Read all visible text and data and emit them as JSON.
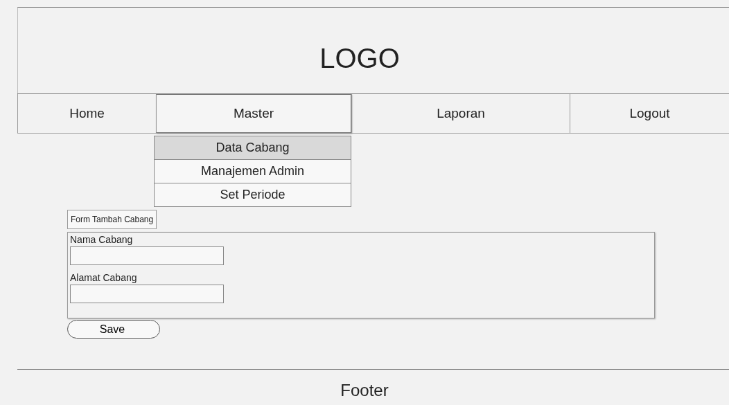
{
  "header": {
    "logo": "LOGO"
  },
  "nav": [
    {
      "label": "Home",
      "selected": false
    },
    {
      "label": "Master",
      "selected": true
    },
    {
      "label": "Laporan",
      "selected": false
    },
    {
      "label": "Logout",
      "selected": false
    }
  ],
  "dropdown": [
    {
      "label": "Data Cabang",
      "selected": true
    },
    {
      "label": "Manajemen Admin",
      "selected": false
    },
    {
      "label": "Set Periode",
      "selected": false
    }
  ],
  "form": {
    "title": "Form Tambah Cabang",
    "fields": [
      {
        "label": "Nama Cabang"
      },
      {
        "label": "Alamat Cabang"
      }
    ],
    "button": "Save"
  },
  "footer": "Footer"
}
